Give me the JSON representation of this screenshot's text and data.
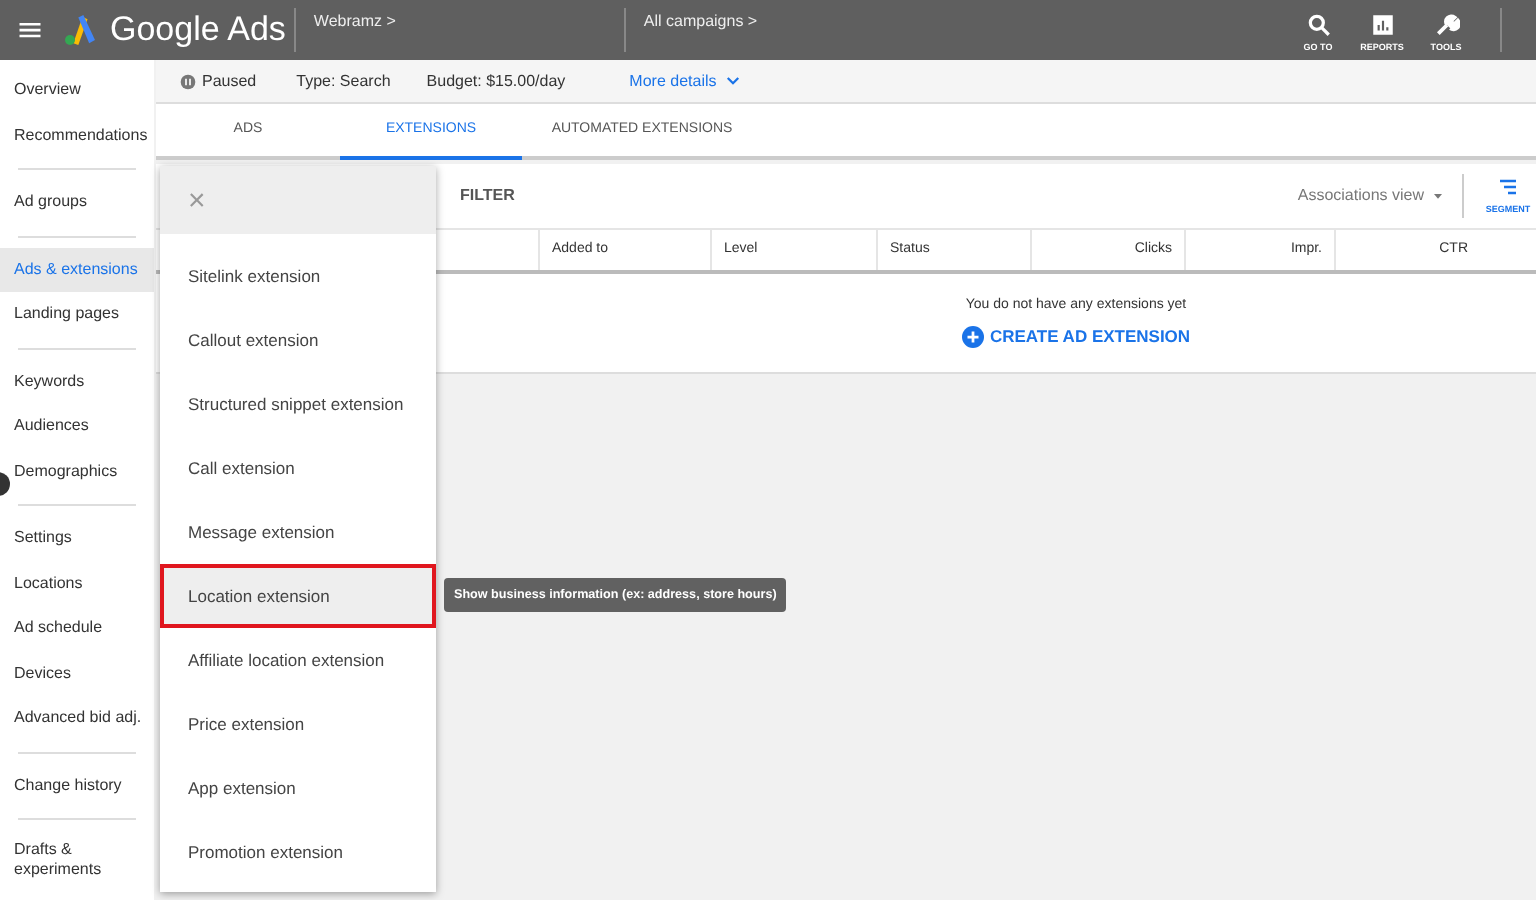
{
  "header": {
    "brand": "Google Ads",
    "account": "Webramz",
    "account_arrow": ">",
    "campaign": "All campaigns",
    "campaign_arrow": ">",
    "tools": [
      {
        "kind": "search",
        "label": "GO TO"
      },
      {
        "kind": "reports",
        "label": "REPORTS"
      },
      {
        "kind": "tools",
        "label": "TOOLS"
      }
    ]
  },
  "sidebar": {
    "groups": [
      [
        {
          "label": "Overview",
          "selected": false
        },
        {
          "label": "Recommendations",
          "selected": false
        }
      ],
      [
        {
          "label": "Ad groups",
          "selected": false
        }
      ],
      [
        {
          "label": "Ads & extensions",
          "selected": true
        },
        {
          "label": "Landing pages",
          "selected": false
        }
      ],
      [
        {
          "label": "Keywords",
          "selected": false
        },
        {
          "label": "Audiences",
          "selected": false
        },
        {
          "label": "Demographics",
          "selected": false
        }
      ],
      [
        {
          "label": "Settings",
          "selected": false
        },
        {
          "label": "Locations",
          "selected": false
        },
        {
          "label": "Ad schedule",
          "selected": false
        },
        {
          "label": "Devices",
          "selected": false
        },
        {
          "label": "Advanced bid adj.",
          "selected": false
        }
      ],
      [
        {
          "label": "Change history",
          "selected": false
        }
      ],
      [
        {
          "label": "Drafts & experiments",
          "selected": false
        }
      ]
    ]
  },
  "status_strip": {
    "status": "Paused",
    "type": "Type: Search",
    "budget": "Budget: $15.00/day",
    "more": "More details"
  },
  "tabs": [
    {
      "label": "ADS",
      "selected": false
    },
    {
      "label": "EXTENSIONS",
      "selected": true
    },
    {
      "label": "AUTOMATED EXTENSIONS",
      "selected": false
    }
  ],
  "toolbar": {
    "filter": "FILTER",
    "view": "Associations view",
    "segment": "SEGMENT"
  },
  "table": {
    "columns": [
      "Added to",
      "Level",
      "Status",
      "Clicks",
      "Impr.",
      "CTR"
    ],
    "empty_message": "You do not have any extensions yet",
    "create": "CREATE AD EXTENSION"
  },
  "menu": {
    "close": "×",
    "items": [
      {
        "label": "Sitelink extension",
        "highlighted": false
      },
      {
        "label": "Callout extension",
        "highlighted": false
      },
      {
        "label": "Structured snippet extension",
        "highlighted": false
      },
      {
        "label": "Call extension",
        "highlighted": false
      },
      {
        "label": "Message extension",
        "highlighted": false
      },
      {
        "label": "Location extension",
        "highlighted": true
      },
      {
        "label": "Affiliate location extension",
        "highlighted": false
      },
      {
        "label": "Price extension",
        "highlighted": false
      },
      {
        "label": "App extension",
        "highlighted": false
      },
      {
        "label": "Promotion extension",
        "highlighted": false
      }
    ]
  },
  "tooltip": "Show business information (ex: address, store hours)"
}
